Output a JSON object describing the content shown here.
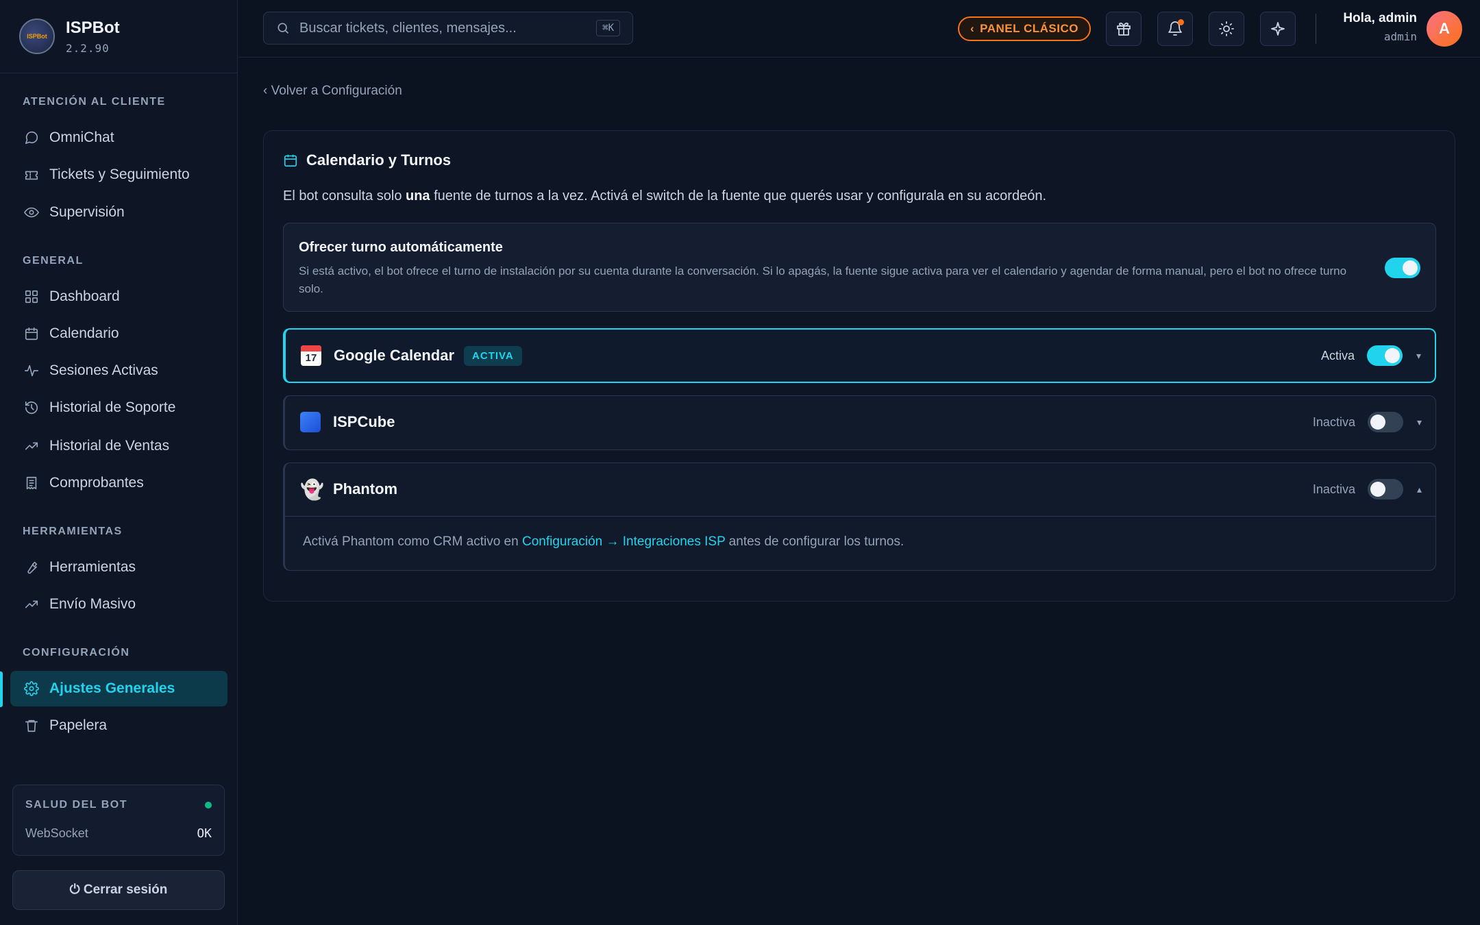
{
  "brand": {
    "name": "ISPBot",
    "version": "2.2.90",
    "logo_text": "ISPBot"
  },
  "sidebar": {
    "sections": [
      {
        "title": "ATENCIÓN AL CLIENTE"
      },
      {
        "title": "GENERAL"
      },
      {
        "title": "HERRAMIENTAS"
      },
      {
        "title": "CONFIGURACIÓN"
      }
    ],
    "items": [
      {
        "label": "OmniChat",
        "icon": "chat-bubble-icon"
      },
      {
        "label": "Tickets y Seguimiento",
        "icon": "ticket-icon"
      },
      {
        "label": "Supervisión",
        "icon": "eye-icon"
      },
      {
        "label": "Dashboard",
        "icon": "grid-icon"
      },
      {
        "label": "Calendario",
        "icon": "calendar-icon"
      },
      {
        "label": "Sesiones Activas",
        "icon": "activity-icon"
      },
      {
        "label": "Historial de Soporte",
        "icon": "history-icon"
      },
      {
        "label": "Historial de Ventas",
        "icon": "trending-up-icon"
      },
      {
        "label": "Comprobantes",
        "icon": "receipt-icon"
      },
      {
        "label": "Herramientas",
        "icon": "wrench-icon"
      },
      {
        "label": "Envío Masivo",
        "icon": "trending-up-icon"
      },
      {
        "label": "Ajustes Generales",
        "icon": "gear-icon",
        "active": true
      },
      {
        "label": "Papelera",
        "icon": "trash-icon"
      }
    ],
    "health": {
      "title": "SALUD DEL BOT",
      "row_label": "WebSocket",
      "row_value": "OK",
      "status_color": "#10b981"
    },
    "logout_label": "⏻ Cerrar sesión"
  },
  "topbar": {
    "search_placeholder": "Buscar tickets, clientes, mensajes...",
    "search_shortcut": "⌘K",
    "classic_button": "PANEL CLÁSICO",
    "user_greeting": "Hola, admin",
    "user_role": "admin",
    "avatar_letter": "A"
  },
  "main": {
    "back_link": "‹ Volver a Configuración",
    "title": "Calendario y Turnos",
    "desc_before": "El bot consulta solo ",
    "desc_bold": "una",
    "desc_after": " fuente de turnos a la vez. Activá el switch de la fuente que querés usar y configurala en su acordeón.",
    "auto_offer": {
      "title": "Ofrecer turno automáticamente",
      "description": "Si está activo, el bot ofrece el turno de instalación por su cuenta durante la conversación. Si lo apagás, la fuente sigue activa para ver el calendario y agendar de forma manual, pero el bot no ofrece turno solo.",
      "enabled": true
    },
    "sources": [
      {
        "name": "Google Calendar",
        "badge": "ACTIVA",
        "status": "Activa",
        "enabled": true,
        "icon": "calendar-emoji-icon",
        "cal_num": "17",
        "chevron": "▾"
      },
      {
        "name": "ISPCube",
        "status": "Inactiva",
        "enabled": false,
        "icon": "blue-square-icon",
        "chevron": "▾"
      },
      {
        "name": "Phantom",
        "status": "Inactiva",
        "enabled": false,
        "icon": "ghost-emoji",
        "emoji": "👻",
        "chevron": "▴",
        "body_before": "Activá Phantom como CRM activo en ",
        "body_link": "Configuración → Integraciones ISP",
        "body_after": " antes de configurar los turnos."
      }
    ]
  },
  "colors": {
    "accent": "#22d3ee",
    "warning": "#f97316",
    "background": "#0b1220"
  }
}
